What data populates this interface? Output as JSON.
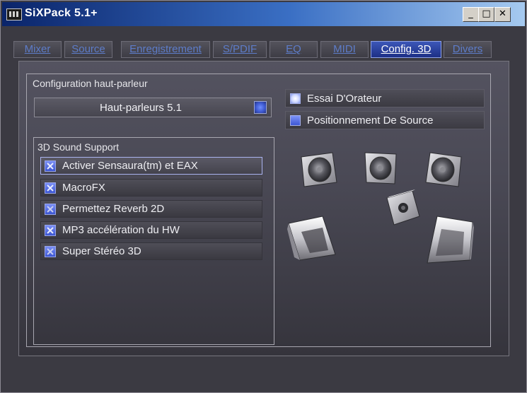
{
  "window": {
    "title": "SiXPack 5.1+",
    "minimize": "_",
    "maximize": "□",
    "close": "✕"
  },
  "tabs": [
    {
      "label": "Mixer"
    },
    {
      "label": "Source"
    },
    {
      "label": "Enregistrement"
    },
    {
      "label": "S/PDIF"
    },
    {
      "label": "EQ"
    },
    {
      "label": "MIDI"
    },
    {
      "label": "Config. 3D",
      "active": true
    },
    {
      "label": "Divers"
    }
  ],
  "speaker_config": {
    "group_label": "Configuration haut-parleur",
    "selected": "Haut-parleurs  5.1"
  },
  "options": {
    "speaker_test": "Essai D'Orateur",
    "source_positioning": "Positionnement De Source"
  },
  "sound3d": {
    "group_label": "3D Sound Support",
    "items": [
      {
        "label": "Activer Sensaura(tm) et EAX",
        "checked": true
      },
      {
        "label": "MacroFX",
        "checked": true
      },
      {
        "label": "Permettez Reverb 2D",
        "checked": true
      },
      {
        "label": "MP3 accélération du HW",
        "checked": true
      },
      {
        "label": "Super Stéréo 3D",
        "checked": true
      }
    ]
  },
  "speakers": [
    {
      "name": "front-left-speaker-icon"
    },
    {
      "name": "center-speaker-icon"
    },
    {
      "name": "front-right-speaker-icon"
    },
    {
      "name": "subwoofer-icon"
    },
    {
      "name": "rear-left-speaker-icon"
    },
    {
      "name": "rear-right-speaker-icon"
    }
  ]
}
